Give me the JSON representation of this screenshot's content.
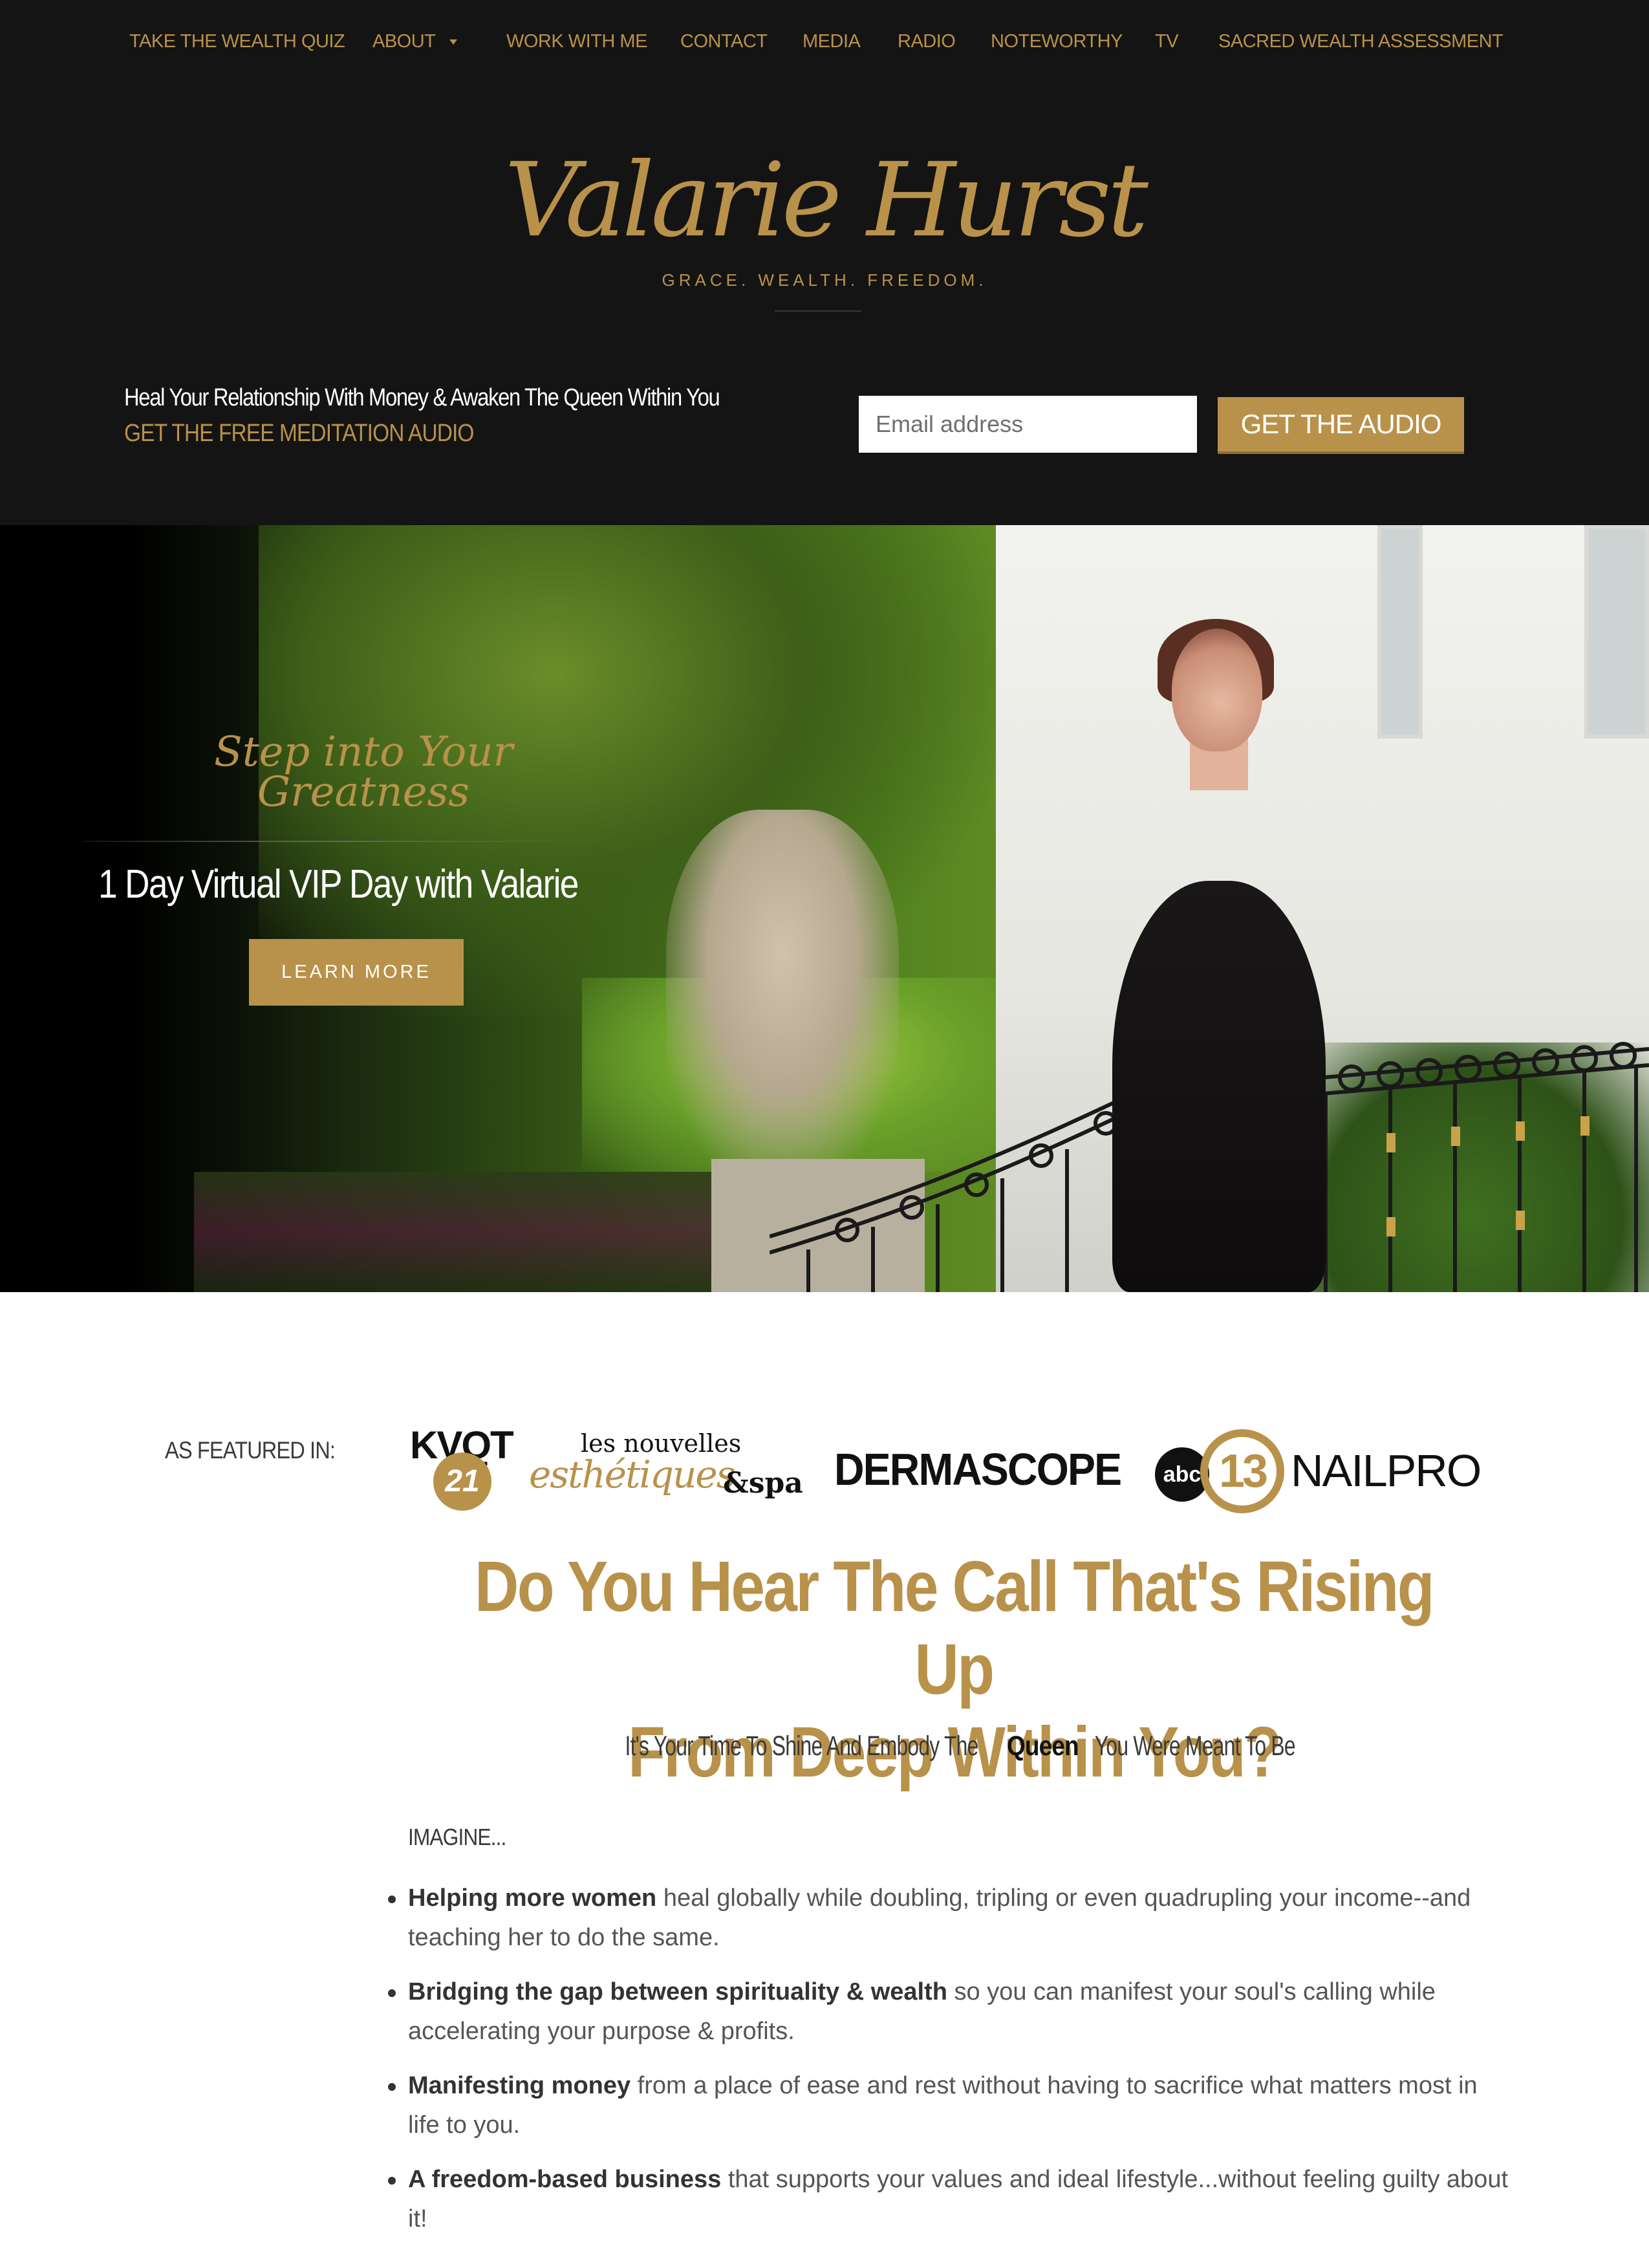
{
  "nav": {
    "items": [
      "TAKE THE WEALTH QUIZ",
      "ABOUT",
      "WORK WITH ME",
      "CONTACT",
      "MEDIA",
      "RADIO",
      "NOTEWORTHY",
      "TV",
      "SACRED WEALTH ASSESSMENT"
    ]
  },
  "logo": {
    "name": "Valarie Hurst",
    "tagline": "GRACE. WEALTH. FREEDOM."
  },
  "optin": {
    "headline": "Heal Your Relationship With Money & Awaken The Queen Within You",
    "subline": "GET THE FREE MEDITATION AUDIO",
    "email_placeholder": "Email address",
    "button_label": "GET THE AUDIO"
  },
  "hero": {
    "script_line1": "Step into Your",
    "script_line2": "Greatness",
    "title": "1 Day Virtual VIP Day with Valarie",
    "button_label": "LEARN MORE"
  },
  "featured": {
    "label": "AS FEATURED IN:",
    "logos": {
      "kvqt": "KVQT",
      "kvqt_number": "21",
      "lesnouvelles_top": "les nouvelles",
      "lesnouvelles_script": "esthétiques",
      "lesnouvelles_spa": "&spa",
      "dermascope": "DERMASCOPE",
      "abc": "abc",
      "abc_number": "13",
      "nailpro": "NAILPRO"
    }
  },
  "content": {
    "headline_line1": "Do You Hear The Call That's Rising Up",
    "headline_line2": "From Deep Within You?",
    "subhead_before": "It's Your Time To Shine And Embody The ",
    "subhead_bold": "Queen",
    "subhead_after": " You Were Meant To Be",
    "imagine": "IMAGINE...",
    "bullets": [
      {
        "bold": "Helping more women",
        "text": " heal globally while doubling, tripling or even quadrupling your income--and teaching her to do the same."
      },
      {
        "bold": "Bridging the gap between spirituality & wealth",
        "text": "  so you can manifest your soul's calling while accelerating your purpose & profits."
      },
      {
        "bold": "Manifesting money",
        "text": " from a place of ease and rest without having to sacrifice what matters most in life to you."
      },
      {
        "bold": "A freedom-based business",
        "text": " that supports your values and ideal lifestyle...without feeling guilty about it!"
      }
    ]
  },
  "colors": {
    "gold": "#b8924a",
    "header_bg": "#151414",
    "body_text": "#3a3a3a"
  }
}
